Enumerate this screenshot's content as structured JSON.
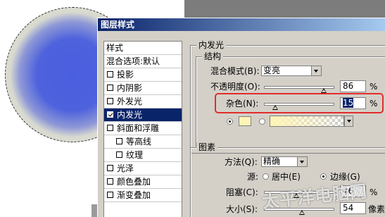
{
  "dialog": {
    "title": "图层样式"
  },
  "styles_list": {
    "header": "样式",
    "blending_options": "混合选项:默认",
    "items": [
      {
        "label": "投影",
        "checked": false
      },
      {
        "label": "内阴影",
        "checked": false
      },
      {
        "label": "外发光",
        "checked": false
      },
      {
        "label": "内发光",
        "checked": true,
        "selected": true
      },
      {
        "label": "斜面和浮雕",
        "checked": false
      },
      {
        "label": "等高线",
        "checked": false
      },
      {
        "label": "纹理",
        "checked": false
      },
      {
        "label": "光泽",
        "checked": false
      },
      {
        "label": "颜色叠加",
        "checked": false
      },
      {
        "label": "渐变叠加",
        "checked": false
      }
    ]
  },
  "inner_glow": {
    "title": "内发光",
    "structure": {
      "title": "结构",
      "blend_mode_label": "混合模式(B):",
      "blend_mode_value": "变亮",
      "opacity_label": "不透明度(O):",
      "opacity_value": "86",
      "opacity_unit": "%",
      "opacity_fraction": 0.86,
      "noise_label": "杂色(N):",
      "noise_value": "15",
      "noise_unit": "%",
      "noise_fraction": 0.15,
      "solid_color": "#fff4b6",
      "gradient_start": "#fff4b6"
    },
    "elements": {
      "title": "图素",
      "method_label": "方法(Q):",
      "method_value": "精确",
      "source_label": "源:",
      "source_center": "居中(E)",
      "source_edge": "边缘(G)",
      "source_selected": "edge",
      "choke_label": "阻塞(C):",
      "choke_value": "46",
      "choke_unit": "%",
      "choke_fraction": 0.46,
      "size_label": "大小(S):",
      "size_value": "54",
      "size_unit": "像素",
      "size_fraction": 0.54
    }
  },
  "canvas": {
    "glow_center_color": "#4a5ee0",
    "glow_edge_color": "#e6e6dc"
  },
  "watermark": "太平洋电脑网"
}
